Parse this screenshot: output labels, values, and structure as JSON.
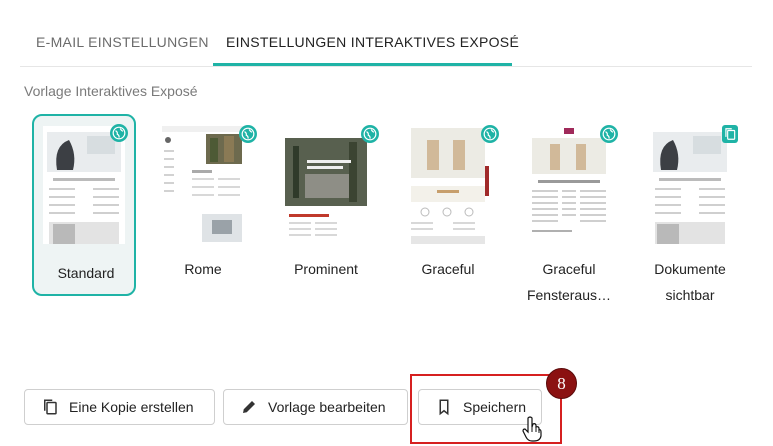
{
  "tabs": [
    {
      "label": "E-MAIL EINSTELLUNGEN",
      "active": false
    },
    {
      "label": "EINSTELLUNGEN INTERAKTIVES EXPOSÉ",
      "active": true
    }
  ],
  "section_label": "Vorlage Interaktives Exposé",
  "templates": [
    {
      "name": "Standard",
      "selected": true,
      "badge": "globe-icon"
    },
    {
      "name": "Rome",
      "selected": false,
      "badge": "globe-icon"
    },
    {
      "name": "Prominent",
      "selected": false,
      "badge": "globe-icon"
    },
    {
      "name": "Graceful",
      "selected": false,
      "badge": "globe-icon"
    },
    {
      "name": "Graceful Fensteraus…",
      "selected": false,
      "badge": "globe-icon"
    },
    {
      "name": "Dokumente sichtbar",
      "selected": false,
      "badge": "copy-icon"
    }
  ],
  "buttons": {
    "copy": "Eine Kopie erstellen",
    "edit": "Vorlage bearbeiten",
    "save": "Speichern"
  },
  "annotation": {
    "step_number": "8"
  },
  "colors": {
    "accent": "#1fb3a6",
    "highlight": "#d62020",
    "step_badge": "#8b1111"
  }
}
